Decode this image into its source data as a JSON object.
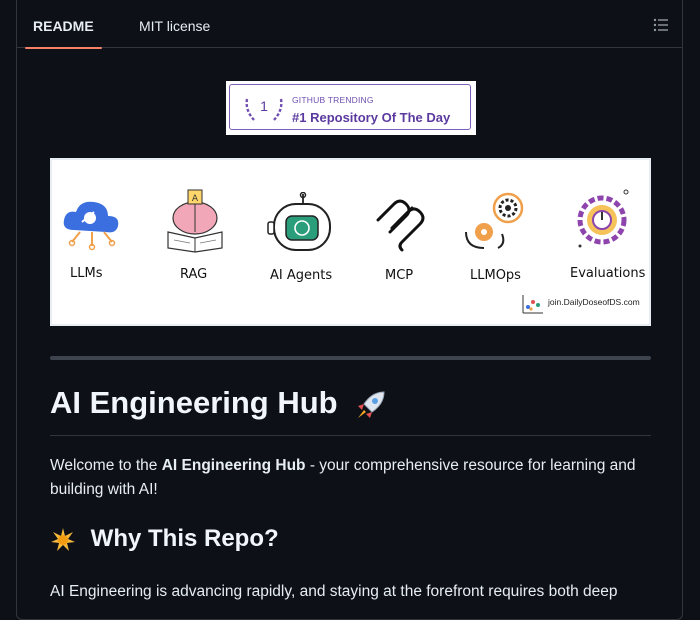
{
  "tabs": [
    {
      "label": "README",
      "active": true
    },
    {
      "label": "MIT license",
      "active": false
    }
  ],
  "outline_button": {
    "icon": "list-unordered-icon"
  },
  "trending_badge": {
    "rank": "1",
    "small_text": "GITHUB TRENDING",
    "big_text": "#1 Repository Of The Day"
  },
  "topics_banner": {
    "items": [
      {
        "label": "LLMs",
        "icon": "cloud-llm-icon"
      },
      {
        "label": "RAG",
        "icon": "brain-book-icon"
      },
      {
        "label": "AI Agents",
        "icon": "robot-icon"
      },
      {
        "label": "MCP",
        "icon": "mcp-logo-icon"
      },
      {
        "label": "LLMOps",
        "icon": "gears-icon"
      },
      {
        "label": "Evaluations",
        "icon": "evaluation-gauge-icon"
      }
    ],
    "watermark": "join.DailyDoseofDS.com"
  },
  "readme": {
    "title": "AI Engineering Hub",
    "title_emoji": "rocket-icon",
    "intro_before": "Welcome to the ",
    "intro_bold": "AI Engineering Hub",
    "intro_after": " - your comprehensive resource for learning and building with AI!",
    "section_title": "Why This Repo?",
    "section_emoji": "sparkle-sun-icon",
    "section_text": "AI Engineering is advancing rapidly, and staying at the forefront requires both deep"
  },
  "colors": {
    "background": "#0d1117",
    "tab_underline": "#f78166",
    "border": "#30363d",
    "badge_purple": "#5b3aa0"
  }
}
